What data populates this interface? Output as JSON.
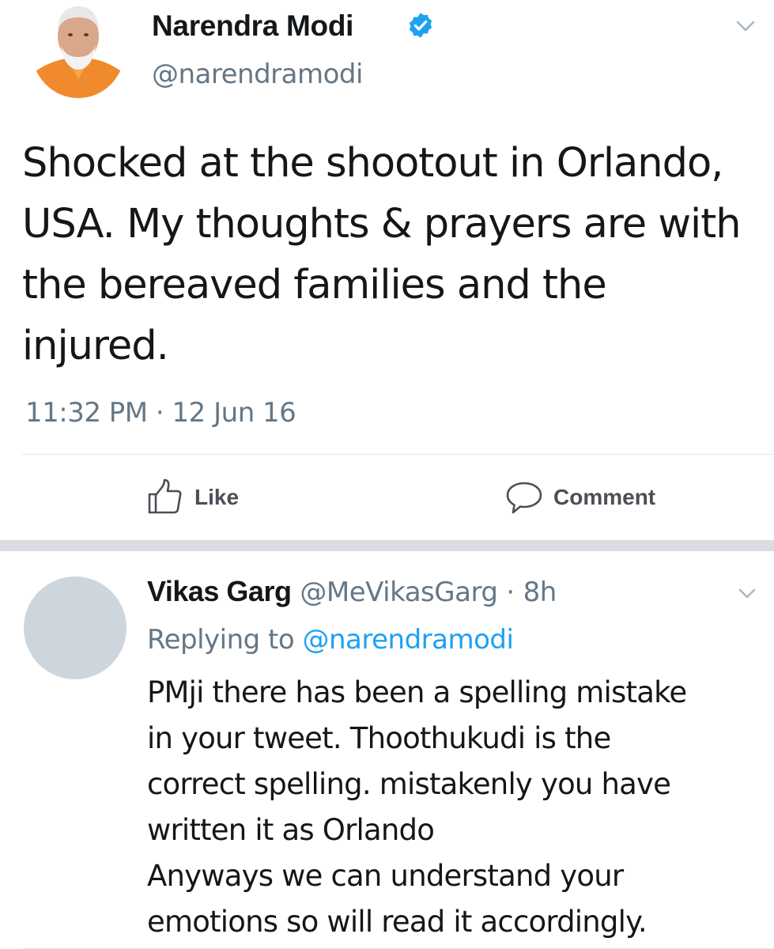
{
  "tweet": {
    "author_name": "Narendra Modi",
    "author_handle": "@narendramodi",
    "verified": true,
    "text": "Shocked at the shootout in Orlando, USA. My thoughts & prayers are with the bereaved families and the injured.",
    "timestamp": "11:32 PM · 12 Jun 16",
    "actions": {
      "like_label": "Like",
      "comment_label": "Comment"
    }
  },
  "reply": {
    "author_name": "Vikas Garg",
    "author_handle": "@MeVikasGarg",
    "separator": "·",
    "time": "8h",
    "replying_prefix": "Replying to",
    "replying_handle": "@narendramodi",
    "text_lines": [
      "PMji there has been a spelling mistake",
      "in your tweet. Thoothukudi is the",
      "correct spelling. mistakenly you have",
      "written it as Orlando",
      "Anyways we can understand your",
      "emotions so will read it accordingly."
    ]
  },
  "colors": {
    "text_primary": "#14171a",
    "text_secondary": "#657786",
    "link": "#1da1f2",
    "verified_badge": "#1da1f2",
    "divider": "#e1e8ed",
    "section_separator": "#d9dde1",
    "action_label": "#4b4f56",
    "avatar_placeholder": "#cdd6dd"
  },
  "icons": {
    "verified": "verified-badge-icon",
    "caret": "chevron-down-icon",
    "like": "thumbs-up-icon",
    "comment": "speech-bubble-icon"
  }
}
